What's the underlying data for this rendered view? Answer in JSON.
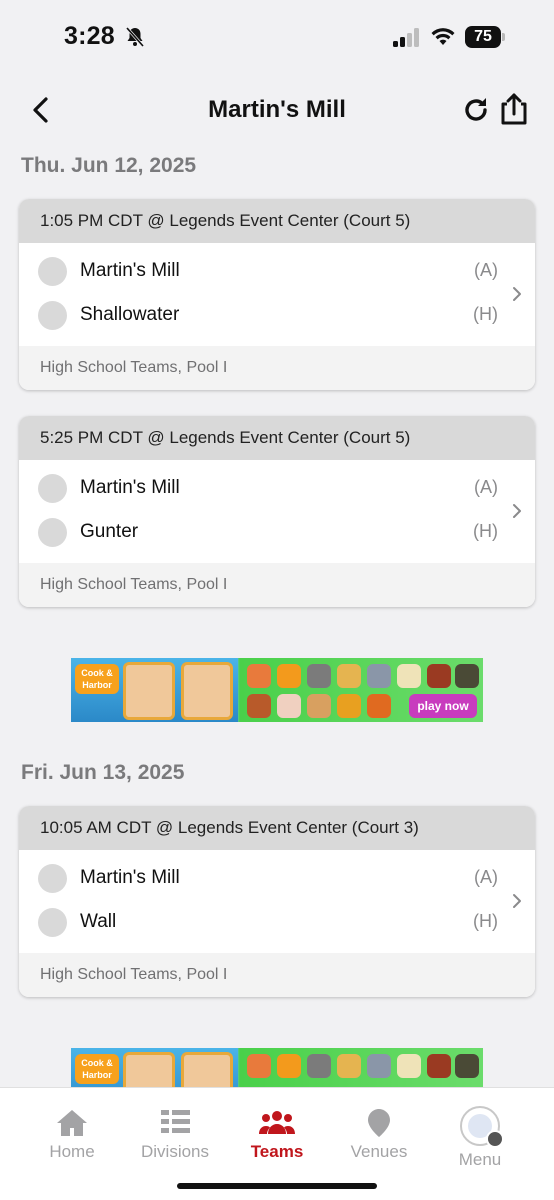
{
  "status_bar": {
    "time": "3:28",
    "battery": "75"
  },
  "header": {
    "title": "Martin's Mill"
  },
  "days": [
    {
      "date": "Thu. Jun 12, 2025",
      "games": [
        {
          "time_venue": "1:05 PM CDT @ Legends Event Center (Court 5)",
          "team_a": "Martin's Mill",
          "team_a_side": "(A)",
          "team_h": "Shallowater",
          "team_h_side": "(H)",
          "division": "High School Teams, Pool I"
        },
        {
          "time_venue": "5:25 PM CDT @ Legends Event Center (Court 5)",
          "team_a": "Martin's Mill",
          "team_a_side": "(A)",
          "team_h": "Gunter",
          "team_h_side": "(H)",
          "division": "High School Teams, Pool I"
        }
      ]
    },
    {
      "date": "Fri. Jun 13, 2025",
      "games": [
        {
          "time_venue": "10:05 AM CDT @ Legends Event Center (Court 3)",
          "team_a": "Martin's Mill",
          "team_a_side": "(A)",
          "team_h": "Wall",
          "team_h_side": "(H)",
          "division": "High School Teams, Pool I"
        }
      ]
    }
  ],
  "ad": {
    "logo_text": "Cook & Harbor",
    "cta": "play now"
  },
  "tabs": [
    {
      "label": "Home",
      "icon": "home-icon",
      "active": false
    },
    {
      "label": "Divisions",
      "icon": "list-icon",
      "active": false
    },
    {
      "label": "Teams",
      "icon": "people-icon",
      "active": true
    },
    {
      "label": "Venues",
      "icon": "map-pin-icon",
      "active": false
    },
    {
      "label": "Menu",
      "icon": "menu-avatar-icon",
      "active": false
    }
  ],
  "colors": {
    "accent": "#c0161c",
    "background": "#f1f1f3",
    "card_header": "#d9d9d9"
  }
}
